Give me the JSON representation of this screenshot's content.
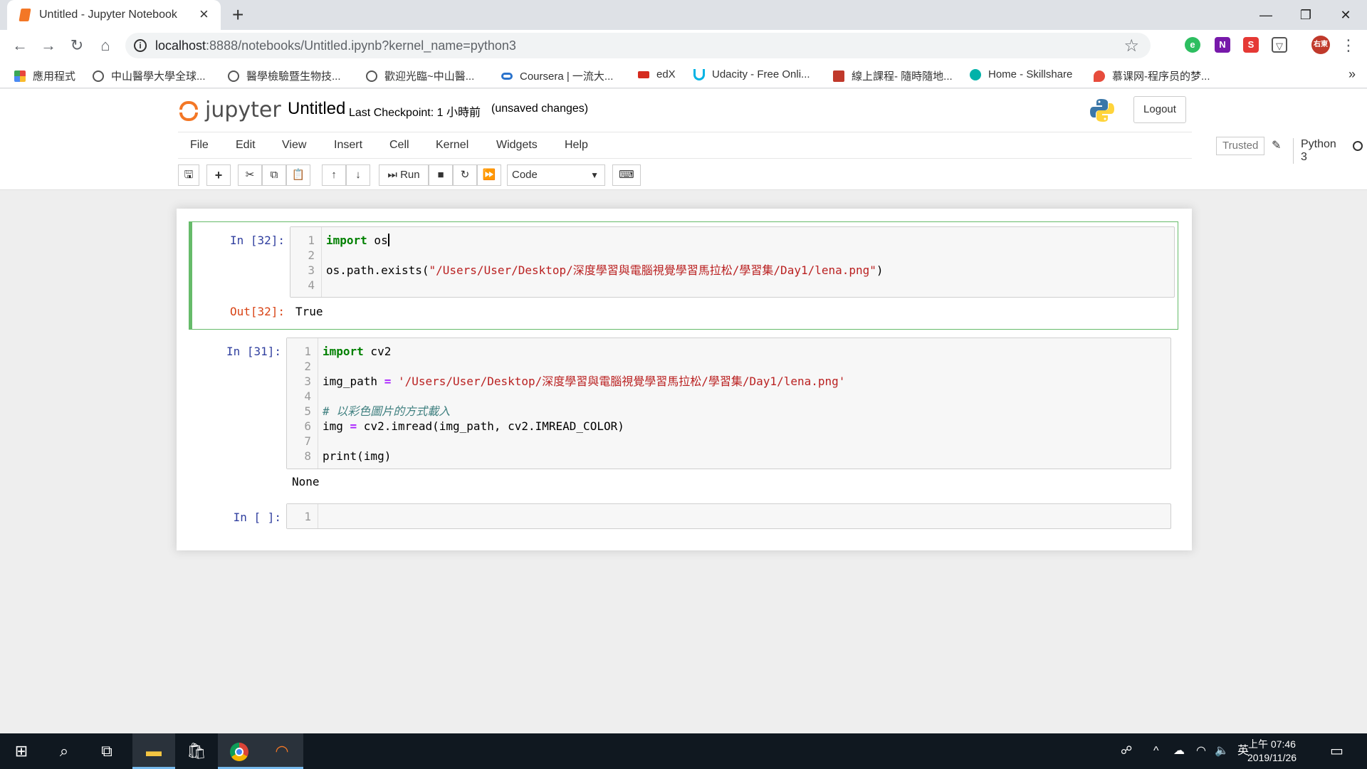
{
  "browser": {
    "tab_title": "Untitled - Jupyter Notebook",
    "tab_close": "×",
    "new_tab": "+",
    "url_host": "localhost",
    "url_path": ":8888/notebooks/Untitled.ipynb?kernel_name=python3",
    "window_controls": {
      "minimize": "—",
      "restore": "❐",
      "close": "✕"
    },
    "bookmarks": [
      {
        "label": "應用程式",
        "color": "#e8453c"
      },
      {
        "label": "中山醫學大學全球...",
        "color": "#555555"
      },
      {
        "label": "醫學檢驗暨生物技...",
        "color": "#555555"
      },
      {
        "label": "歡迎光臨~中山醫...",
        "color": "#555555"
      },
      {
        "label": "Coursera | 一流大...",
        "color": "#2a73cc"
      },
      {
        "label": "edX",
        "color": "#d52b1e"
      },
      {
        "label": "Udacity - Free Onli...",
        "color": "#02b3e4"
      },
      {
        "label": "線上課程- 隨時隨地...",
        "color": "#c0392b"
      },
      {
        "label": "Home - Skillshare",
        "color": "#00b2a9"
      },
      {
        "label": "慕课网-程序员的梦...",
        "color": "#e74c3c"
      }
    ],
    "bookmarks_more": "»",
    "profile_initials": "右東"
  },
  "jupyter": {
    "logo_text": "jupyter",
    "notebook_name": "Untitled",
    "checkpoint": "Last Checkpoint: 1 小時前",
    "autosave": "(unsaved changes)",
    "logout": "Logout",
    "menu": [
      "File",
      "Edit",
      "View",
      "Insert",
      "Cell",
      "Kernel",
      "Widgets",
      "Help"
    ],
    "trusted": "Trusted",
    "kernel": "Python 3",
    "run_label": "Run",
    "cell_type": "Code"
  },
  "cells": [
    {
      "prompt": "In [32]:",
      "lines": [
        "1",
        "2",
        "3",
        "4"
      ],
      "out_prompt": "Out[32]:",
      "output": "True"
    },
    {
      "prompt": "In [31]:",
      "lines": [
        "1",
        "2",
        "3",
        "4",
        "5",
        "6",
        "7",
        "8"
      ],
      "output": "None"
    },
    {
      "prompt": "In [ ]:",
      "lines": [
        "1"
      ]
    }
  ],
  "code": {
    "c1_l1_kw": "import",
    "c1_l1_rest": " os",
    "c1_l3_pre": "os.path.exists(",
    "c1_l3_str": "\"/Users/User/Desktop/深度學習與電腦視覺學習馬拉松/學習集/Day1/lena.png\"",
    "c1_l3_post": ")",
    "c2_l1_kw": "import",
    "c2_l1_rest": " cv2",
    "c2_l3_var": "img_path ",
    "c2_l3_op": "=",
    "c2_l3_str": " '/Users/User/Desktop/深度學習與電腦視覺學習馬拉松/學習集/Day1/lena.png'",
    "c2_l5_cm": "# 以彩色圖片的方式載入",
    "c2_l6_var": "img ",
    "c2_l6_op": "=",
    "c2_l6_rest": " cv2.imread(img_path, cv2.IMREAD_COLOR)",
    "c2_l8": "print(img)"
  },
  "taskbar": {
    "ime": "英",
    "time": "上午 07:46",
    "date": "2019/11/26"
  }
}
